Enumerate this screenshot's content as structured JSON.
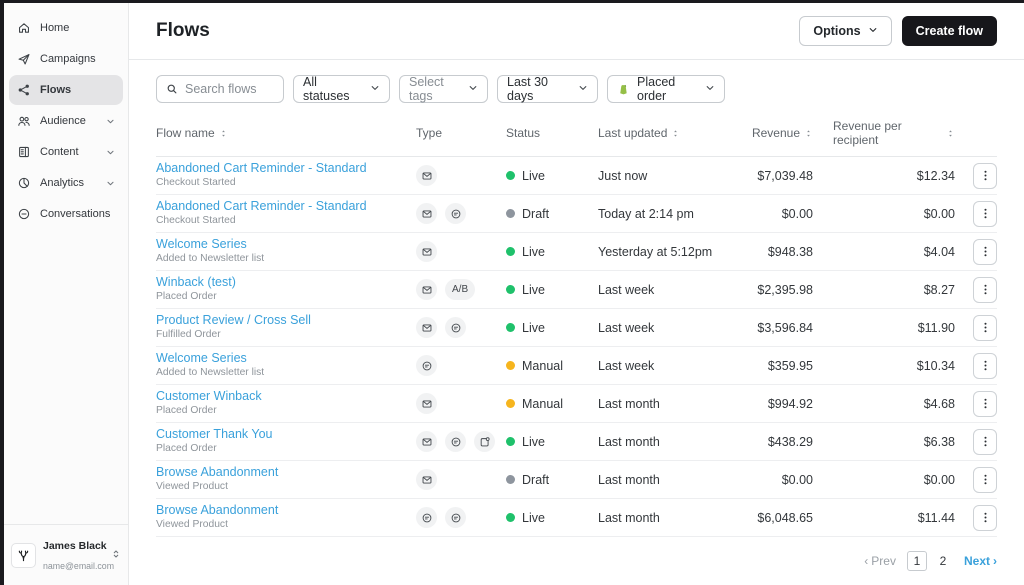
{
  "sidebar": {
    "items": [
      {
        "label": "Home",
        "icon": "home",
        "active": false,
        "expandable": false
      },
      {
        "label": "Campaigns",
        "icon": "send",
        "active": false,
        "expandable": false
      },
      {
        "label": "Flows",
        "icon": "flow",
        "active": true,
        "expandable": false
      },
      {
        "label": "Audience",
        "icon": "audience",
        "active": false,
        "expandable": true
      },
      {
        "label": "Content",
        "icon": "content",
        "active": false,
        "expandable": true
      },
      {
        "label": "Analytics",
        "icon": "analytics",
        "active": false,
        "expandable": true
      },
      {
        "label": "Conversations",
        "icon": "conversations",
        "active": false,
        "expandable": false
      }
    ],
    "user": {
      "name": "James Black",
      "email": "name@email.com",
      "avatar_icon": "stag-logo"
    }
  },
  "header": {
    "title": "Flows",
    "options_label": "Options",
    "create_label": "Create flow"
  },
  "filters": {
    "search_placeholder": "Search flows",
    "statuses": "All statuses",
    "tags": "Select tags",
    "date_range": "Last 30 days",
    "metric": "Placed order",
    "metric_icon": "shopify-bag",
    "metric_icon_color": "#95bf47"
  },
  "table": {
    "columns": [
      {
        "label": "Flow name",
        "sortable": true,
        "align": "left"
      },
      {
        "label": "Type",
        "sortable": false,
        "align": "left"
      },
      {
        "label": "Status",
        "sortable": false,
        "align": "left"
      },
      {
        "label": "Last updated",
        "sortable": true,
        "align": "left"
      },
      {
        "label": "Revenue",
        "sortable": true,
        "align": "right"
      },
      {
        "label": "Revenue per recipient",
        "sortable": true,
        "align": "right"
      },
      {
        "label": "",
        "sortable": false,
        "align": "right"
      }
    ],
    "status_colors": {
      "Live": "#1fc16b",
      "Draft": "#8e959e",
      "Manual": "#f6b51e"
    },
    "rows": [
      {
        "name": "Abandoned Cart Reminder - Standard",
        "trigger": "Checkout Started",
        "types": [
          "email"
        ],
        "status": "Live",
        "updated": "Just now",
        "revenue": "$7,039.48",
        "revenue_per_recipient": "$12.34"
      },
      {
        "name": "Abandoned Cart Reminder - Standard",
        "trigger": "Checkout Started",
        "types": [
          "email",
          "sms"
        ],
        "status": "Draft",
        "updated": "Today at 2:14 pm",
        "revenue": "$0.00",
        "revenue_per_recipient": "$0.00"
      },
      {
        "name": "Welcome Series",
        "trigger": "Added to Newsletter list",
        "types": [
          "email"
        ],
        "status": "Live",
        "updated": "Yesterday at 5:12pm",
        "revenue": "$948.38",
        "revenue_per_recipient": "$4.04"
      },
      {
        "name": "Winback (test)",
        "trigger": "Placed Order",
        "types": [
          "email",
          "ab"
        ],
        "status": "Live",
        "updated": "Last week",
        "revenue": "$2,395.98",
        "revenue_per_recipient": "$8.27"
      },
      {
        "name": "Product Review / Cross Sell",
        "trigger": "Fulfilled Order",
        "types": [
          "email",
          "sms"
        ],
        "status": "Live",
        "updated": "Last week",
        "revenue": "$3,596.84",
        "revenue_per_recipient": "$11.90"
      },
      {
        "name": "Welcome Series",
        "trigger": "Added to Newsletter list",
        "types": [
          "sms"
        ],
        "status": "Manual",
        "updated": "Last week",
        "revenue": "$359.95",
        "revenue_per_recipient": "$10.34"
      },
      {
        "name": "Customer Winback",
        "trigger": "Placed Order",
        "types": [
          "email"
        ],
        "status": "Manual",
        "updated": "Last month",
        "revenue": "$994.92",
        "revenue_per_recipient": "$4.68"
      },
      {
        "name": "Customer Thank You",
        "trigger": "Placed Order",
        "types": [
          "email",
          "sms",
          "mobile-push"
        ],
        "status": "Live",
        "updated": "Last month",
        "revenue": "$438.29",
        "revenue_per_recipient": "$6.38"
      },
      {
        "name": "Browse Abandonment",
        "trigger": "Viewed Product",
        "types": [
          "email"
        ],
        "status": "Draft",
        "updated": "Last month",
        "revenue": "$0.00",
        "revenue_per_recipient": "$0.00"
      },
      {
        "name": "Browse Abandonment",
        "trigger": "Viewed Product",
        "types": [
          "sms",
          "sms"
        ],
        "status": "Live",
        "updated": "Last month",
        "revenue": "$6,048.65",
        "revenue_per_recipient": "$11.44"
      }
    ],
    "ab_badge_label": "A/B"
  },
  "pagination": {
    "prev_label": "Prev",
    "next_label": "Next",
    "pages": [
      "1",
      "2"
    ],
    "current": "1"
  },
  "colors": {
    "link_blue": "#3aa1db",
    "primary_button": "#17171b",
    "active_nav_bg": "#e4e4e6"
  }
}
